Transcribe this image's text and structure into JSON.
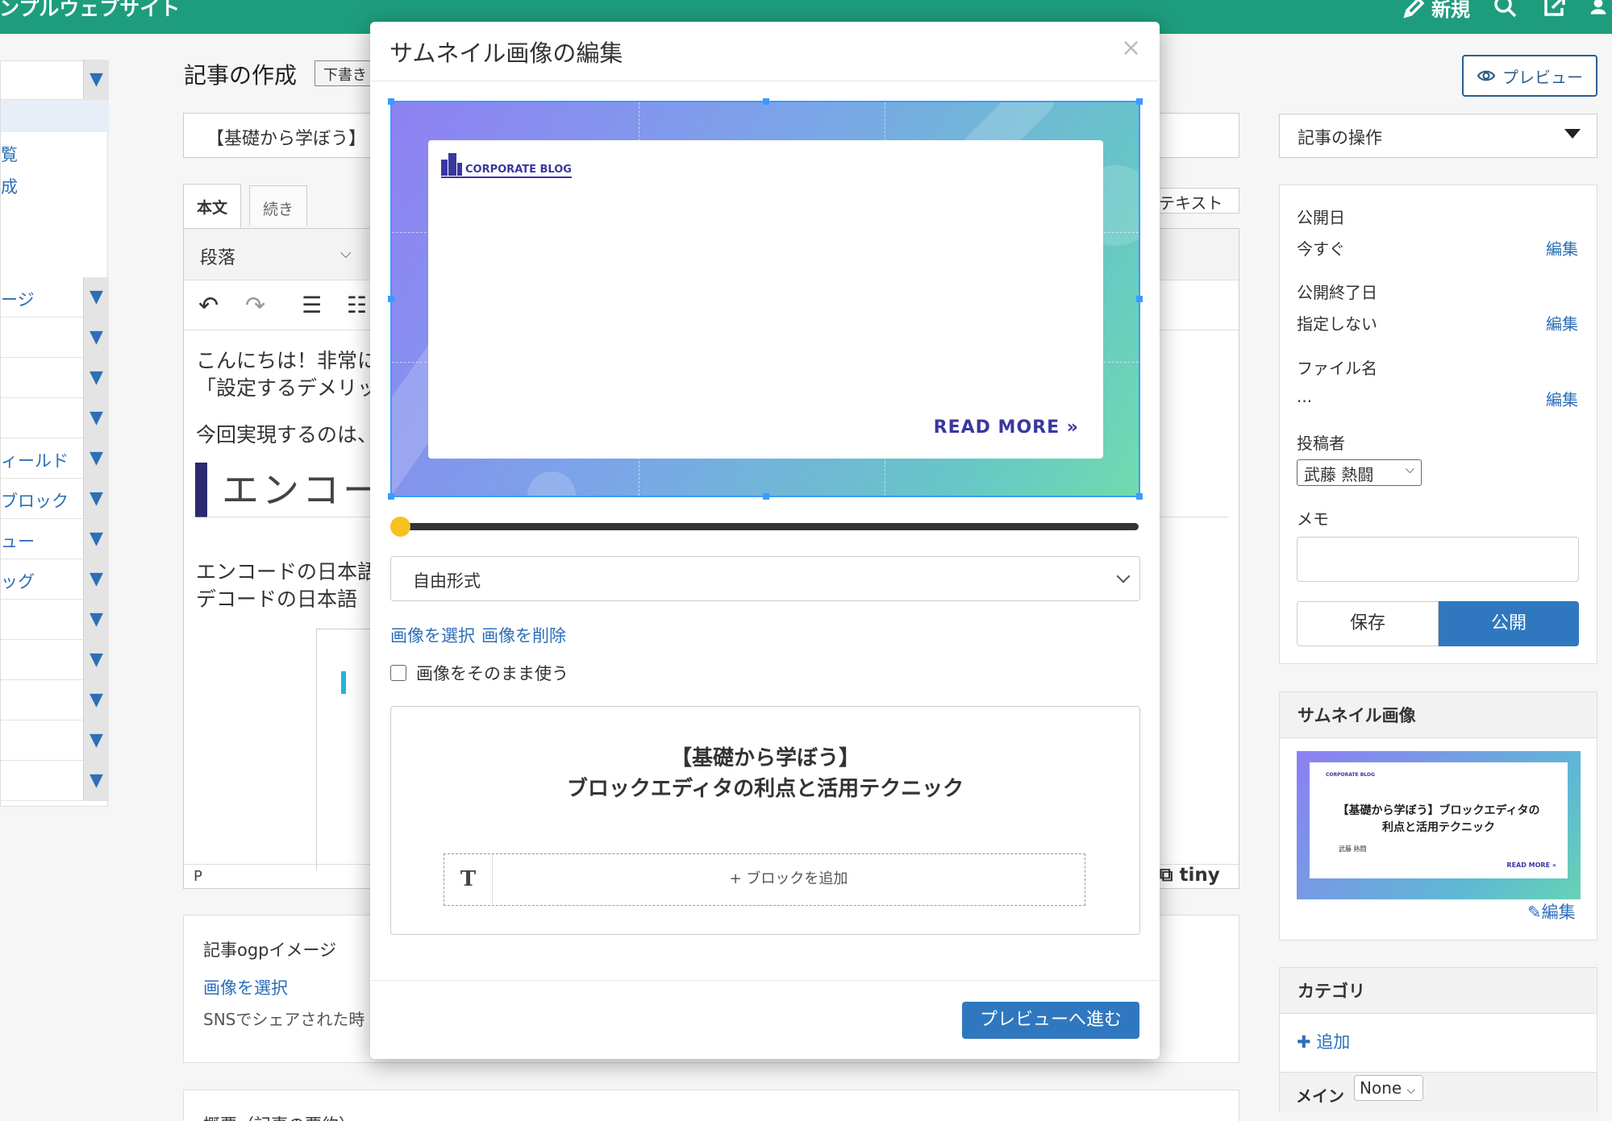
{
  "topbar": {
    "site_name": "シンプルウェブサイト",
    "new_label": "新規"
  },
  "sidebar": {
    "items": [
      {
        "label": ""
      },
      {
        "label": ""
      },
      {
        "label": "覧"
      },
      {
        "label": "成"
      },
      {
        "label": "ージ"
      },
      {
        "label": ""
      },
      {
        "label": ""
      },
      {
        "label": ""
      },
      {
        "label": "ィールド"
      },
      {
        "label": "ブロック"
      },
      {
        "label": "ュー"
      },
      {
        "label": "ッグ"
      },
      {
        "label": ""
      },
      {
        "label": ""
      },
      {
        "label": ""
      },
      {
        "label": ""
      },
      {
        "label": ""
      }
    ],
    "toggle_symbol": "▼"
  },
  "editor": {
    "heading": "記事の作成",
    "status_badge": "下書き",
    "title_value": "【基礎から学ぼう】",
    "tabs": [
      "本文",
      "続き"
    ],
    "paragraph_select": "段落",
    "text_mode_select": "テキスト",
    "body_line1": "こんにちは！非常に",
    "body_line2": "「設定するデメリッ",
    "body_line3": "今回実現するのは、",
    "body_heading": "エンコー",
    "body_line4": "エンコードの日本語",
    "body_line5": "デコードの日本語",
    "status_path": "P",
    "tiny_brand": "tiny"
  },
  "ogp": {
    "title": "記事ogpイメージ",
    "select_link": "画像を選択",
    "note": "SNSでシェアされた時"
  },
  "summary": {
    "title": "概要（記事の要約）"
  },
  "right": {
    "preview_label": "プレビュー",
    "operations_label": "記事の操作",
    "publish_date_label": "公開日",
    "publish_date_value": "今すぐ",
    "publish_end_label": "公開終了日",
    "publish_end_value": "指定しない",
    "filename_label": "ファイル名",
    "filename_value": "...",
    "edit_label": "編集",
    "author_label": "投稿者",
    "author_value": "武藤 熱闘",
    "memo_label": "メモ",
    "save_label": "保存",
    "publish_label": "公開",
    "thumb_panel_title": "サムネイル画像",
    "thumb_title_line1": "【基礎から学ぼう】ブロックエディタの",
    "thumb_title_line2": "利点と活用テクニック",
    "thumb_logo": "CORPORATE BLOG",
    "thumb_author": "武藤 熱闘",
    "thumb_readmore": "READ MORE »",
    "thumb_edit": "編集",
    "category_title": "カテゴリ",
    "category_add": "追加",
    "category_main": "メイン",
    "category_select": "None"
  },
  "modal": {
    "title": "サムネイル画像の編集",
    "close": "×",
    "image_logo": "CORPORATE BLOG",
    "image_readmore": "READ MORE »",
    "zoom_level": 0.0,
    "ratio_select": "自由形式",
    "select_image_link": "画像を選択",
    "delete_image_link": "画像を削除",
    "use_as_is_label": "画像をそのまま使う",
    "use_as_is_checked": false,
    "thumb_title_line1": "【基礎から学ぼう】",
    "thumb_title_line2": "ブロックエディタの利点と活用テクニック",
    "add_block_label": "+ ブロックを追加",
    "text_block_icon": "T",
    "next_button": "プレビューへ進む"
  },
  "colors": {
    "topbar": "#1e9d7d",
    "primary_button": "#2f78bf",
    "link": "#2c6fb7",
    "slider_knob": "#f7c11e"
  }
}
